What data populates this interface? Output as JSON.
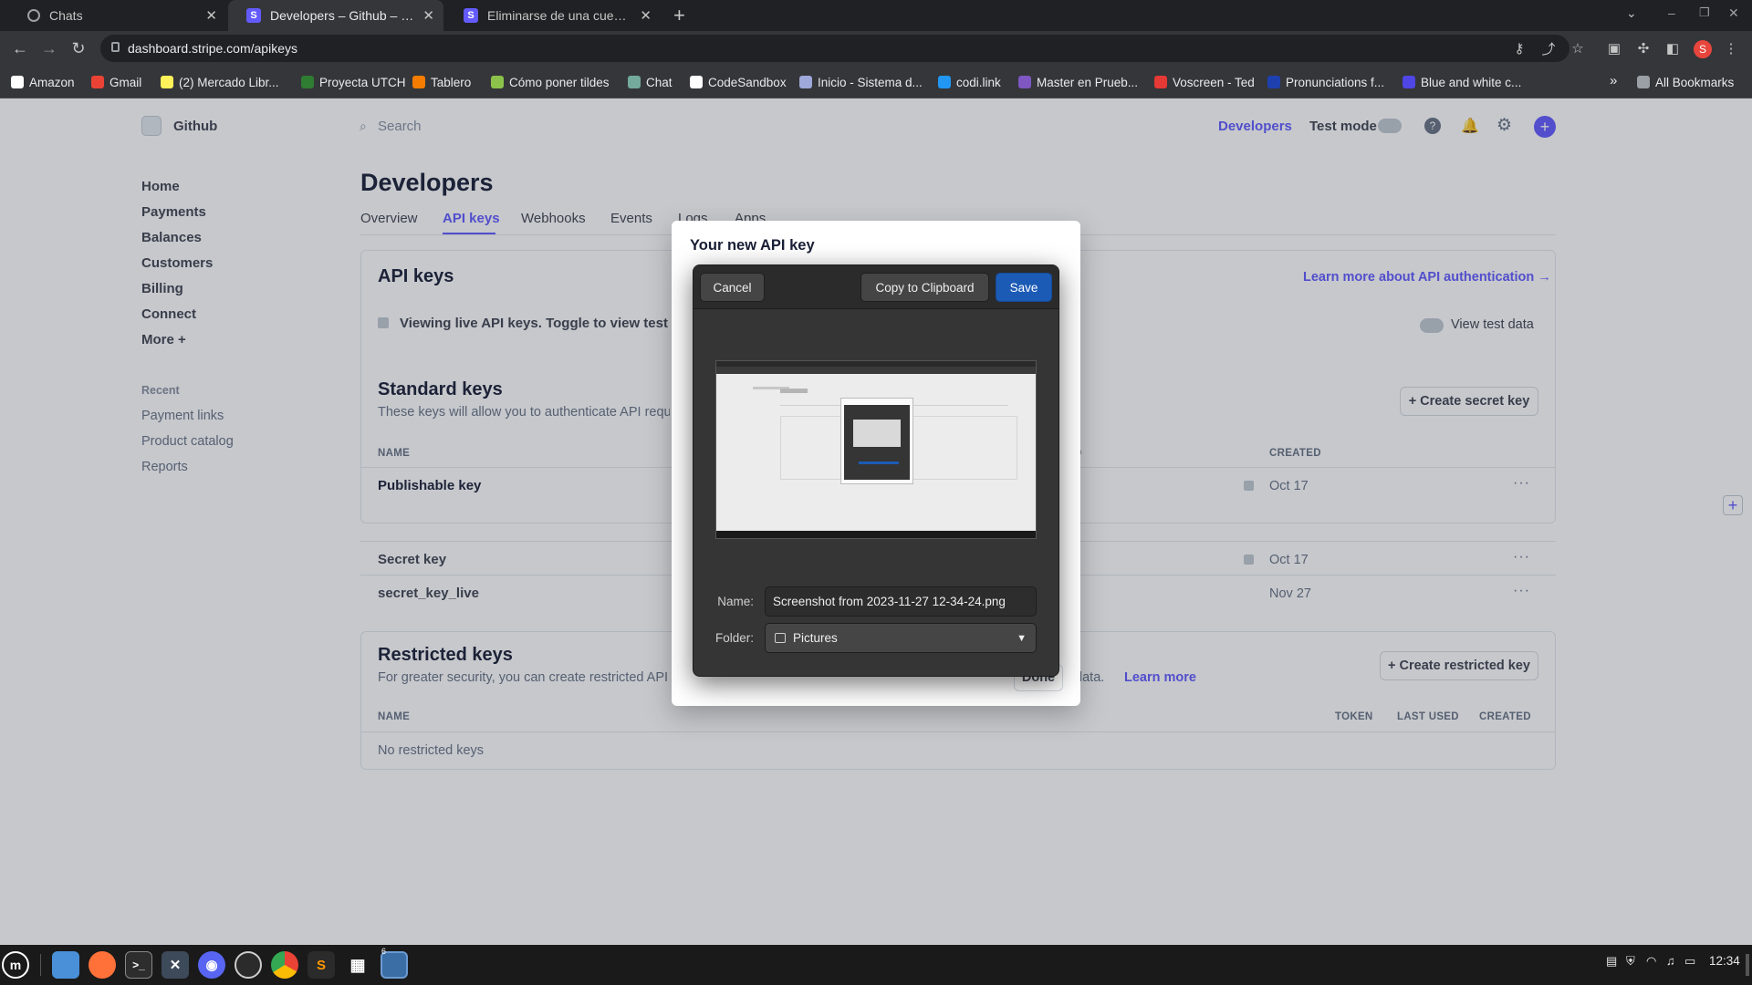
{
  "browser": {
    "tabs": [
      {
        "title": "Chats",
        "icon": "globe-icon",
        "active": false
      },
      {
        "title": "Developers – Github – Stripe",
        "icon": "stripe-icon",
        "active": true
      },
      {
        "title": "Eliminarse de una cuenta de S",
        "icon": "stripe-icon",
        "active": false
      }
    ],
    "new_tab": "+",
    "url": "dashboard.stripe.com/apikeys",
    "profile_initial": "S",
    "bookmarks": [
      {
        "label": "Amazon",
        "color": "#ffffff"
      },
      {
        "label": "Gmail",
        "color": "#ea4335"
      },
      {
        "label": "(2) Mercado Libr...",
        "color": "#fff159"
      },
      {
        "label": "Proyecta UTCH",
        "color": "#2e7d32"
      },
      {
        "label": "Tablero",
        "color": "#f57c00"
      },
      {
        "label": "Cómo poner tildes",
        "color": "#8bc34a"
      },
      {
        "label": "Chat",
        "color": "#74aa9c"
      },
      {
        "label": "CodeSandbox",
        "color": "#ffffff"
      },
      {
        "label": "Inicio - Sistema d...",
        "color": "#9fa8da"
      },
      {
        "label": "codi.link",
        "color": "#2196f3"
      },
      {
        "label": "Master en Prueb...",
        "color": "#7e57c2"
      },
      {
        "label": "Voscreen - Ted",
        "color": "#e53935"
      },
      {
        "label": "Pronunciations f...",
        "color": "#1e40af"
      },
      {
        "label": "Blue and white c...",
        "color": "#4f46e5"
      }
    ],
    "all_bookmarks": "All Bookmarks"
  },
  "stripe": {
    "account": "Github",
    "search_placeholder": "Search",
    "developers_link": "Developers",
    "test_mode": "Test mode",
    "sidebar": {
      "items": [
        "Home",
        "Payments",
        "Balances",
        "Customers",
        "Billing",
        "Connect",
        "More +"
      ],
      "recent_heading": "Recent",
      "recent": [
        "Payment links",
        "Product catalog",
        "Reports"
      ]
    },
    "page_title": "Developers",
    "tabs": [
      "Overview",
      "API keys",
      "Webhooks",
      "Events",
      "Logs",
      "Apps"
    ],
    "api_keys_heading": "API keys",
    "learn_more_auth": "Learn more about API authentication →",
    "banner": "Viewing live API keys. Toggle to view test keys.",
    "view_test_data": "View test data",
    "standard": {
      "heading": "Standard keys",
      "desc": "These keys will allow you to authenticate API requests.",
      "create_button": "+ Create secret key",
      "col_name": "NAME",
      "col_created": "CREATED",
      "col_partial": "D",
      "rows": [
        {
          "name": "Publishable key",
          "created": "Oct 17"
        },
        {
          "name": "Secret key",
          "created": "Oct 17"
        },
        {
          "name": "secret_key_live",
          "created": "Nov 27"
        }
      ],
      "row_menu": "···"
    },
    "restricted": {
      "heading": "Restricted keys",
      "desc": "For greater security, you can create restricted API k",
      "desc_tail": "t data.",
      "learn_more": "Learn more",
      "create_button": "+ Create restricted key",
      "col_name": "NAME",
      "col_token": "TOKEN",
      "col_last_used": "LAST USED",
      "col_created": "CREATED",
      "empty": "No restricted keys"
    },
    "modal": {
      "title": "Your new API key",
      "done": "Done"
    }
  },
  "save_dialog": {
    "cancel": "Cancel",
    "copy": "Copy to Clipboard",
    "save": "Save",
    "name_label": "Name:",
    "name_value": "Screenshot from 2023-11-27 12-34-24.png",
    "folder_label": "Folder:",
    "folder_value": "Pictures"
  },
  "taskbar": {
    "clock": "12:34",
    "workspace_badge": "6"
  }
}
